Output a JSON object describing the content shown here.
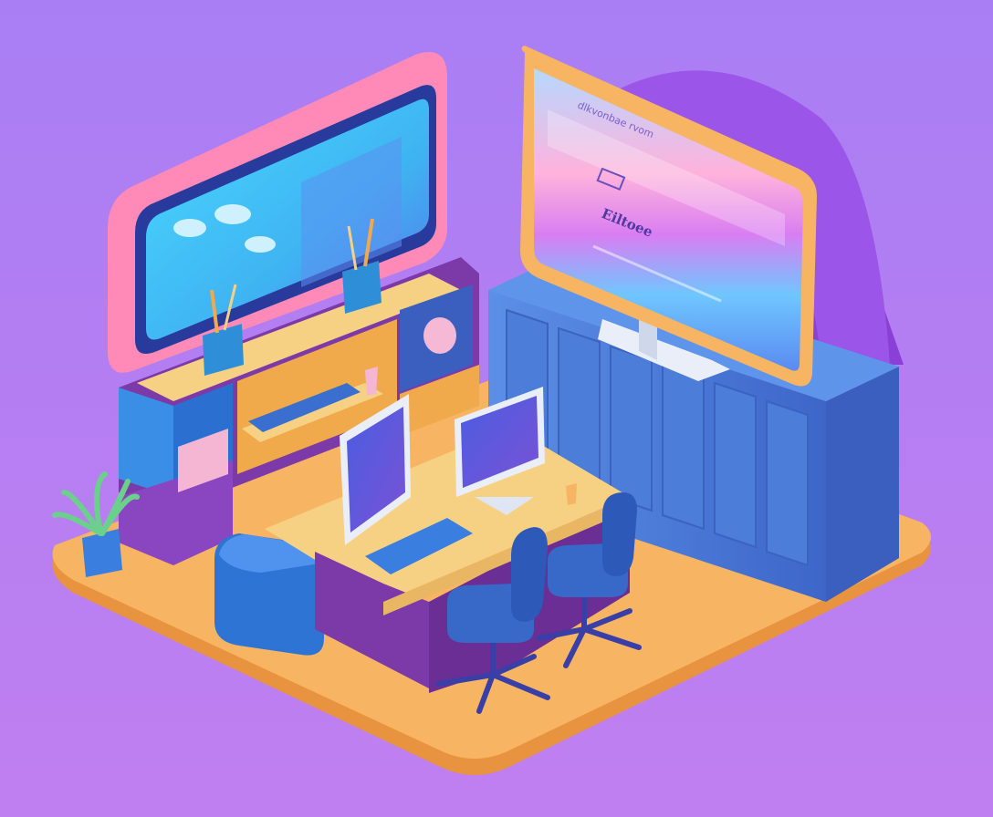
{
  "scene": {
    "description_free": true,
    "palette": {
      "bg_top": "#a97ef4",
      "bg_bottom": "#c07ff0",
      "floor": "#f7b463",
      "floor_edge": "#e8933f",
      "wall_blue": "#4a7fd8",
      "wall_blue_dark": "#3a5fbf",
      "desk_top": "#f7d183",
      "desk_side": "#7c3aa8",
      "screen_cyan": "#41c3f4",
      "screen_pink": "#ff8ab8",
      "monitor_frame_orange": "#f7b463",
      "chair_blue": "#3869c9",
      "plant_green": "#6bd08c"
    }
  },
  "right_monitor_screen": {
    "line_top": "dlkvonbae rvom",
    "brand": "Eiltoee"
  }
}
